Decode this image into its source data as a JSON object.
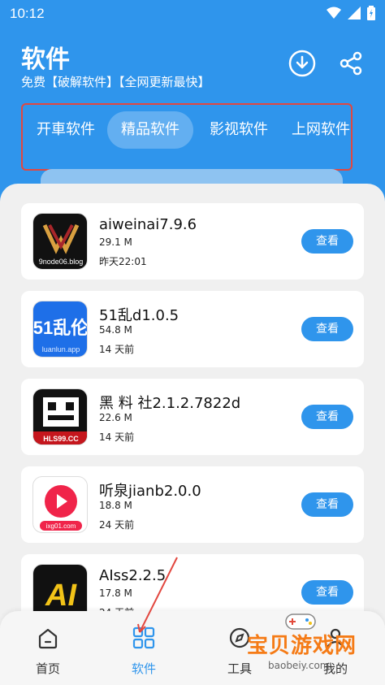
{
  "status": {
    "time": "10:12"
  },
  "header": {
    "title": "软件",
    "subtitle": "免费【破解软件】【全网更新最快】"
  },
  "tabs": [
    {
      "label": "开車软件",
      "active": false
    },
    {
      "label": "精品软件",
      "active": true
    },
    {
      "label": "影视软件",
      "active": false
    },
    {
      "label": "上网软件",
      "active": false
    }
  ],
  "apps": [
    {
      "name": "aiweinai7.9.6",
      "size": "29.1 M",
      "time": "昨天22:01",
      "icon_label": "9node06.blog",
      "button": "查看"
    },
    {
      "name": "51乱d1.0.5",
      "size": "54.8 M",
      "time": "14 天前",
      "icon_label": "luanlun.app",
      "button": "查看"
    },
    {
      "name": "黑 料 社2.1.2.7822d",
      "size": "22.6 M",
      "time": "14 天前",
      "icon_label": "HLS99.CC",
      "button": "查看"
    },
    {
      "name": "听泉jianb2.0.0",
      "size": "18.8 M",
      "time": "24 天前",
      "icon_label": "ixg01.com",
      "button": "查看"
    },
    {
      "name": "AIss2.2.5",
      "size": "17.8 M",
      "time": "24 天前",
      "icon_label": "AI",
      "button": "查看"
    }
  ],
  "bottom_nav": [
    {
      "label": "首页",
      "icon": "home-icon",
      "active": false
    },
    {
      "label": "软件",
      "icon": "grid-icon",
      "active": true
    },
    {
      "label": "工具",
      "icon": "compass-icon",
      "active": false
    },
    {
      "label": "我的",
      "icon": "user-icon",
      "active": false
    }
  ],
  "watermark": {
    "text": "宝贝游戏网",
    "url": "baobeiy.com"
  },
  "colors": {
    "primary": "#2f95ec",
    "highlight_box": "#e2473f",
    "watermark": "#f57b16"
  }
}
